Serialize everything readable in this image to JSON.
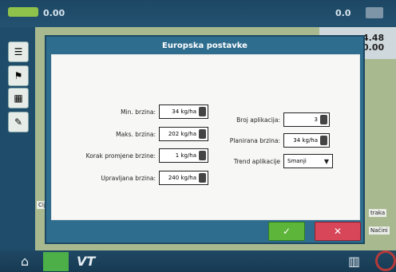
{
  "topbar": {
    "left_value": "0.00",
    "right_value": "0.0"
  },
  "right_panel": {
    "line1": "4.48",
    "line2": "0.00"
  },
  "background_labels": {
    "left": "Cij",
    "traka": "traka",
    "nacini": "Načini"
  },
  "dialog": {
    "title": "Europska postavke",
    "fields": {
      "min_brzina": {
        "label": "Min. brzina:",
        "value": "34 kg/ha"
      },
      "maks_brzina": {
        "label": "Maks. brzina:",
        "value": "202 kg/ha"
      },
      "korak_promjene": {
        "label": "Korak promjene brzine:",
        "value": "1 kg/ha"
      },
      "upravljana_brzina": {
        "label": "Upravljana brzina:",
        "value": "240 kg/ha"
      },
      "broj_aplikacija": {
        "label": "Broj aplikacija:",
        "value": "3"
      },
      "planirana_brzina": {
        "label": "Planirana brzina:",
        "value": "34 kg/ha"
      },
      "trend_aplikacije": {
        "label": "Trend aplikacije",
        "value": "Smanji"
      }
    },
    "buttons": {
      "ok": "✓",
      "cancel": "✕"
    }
  },
  "bottom": {
    "home_icon": "⌂",
    "vt": "VT"
  },
  "colors": {
    "ok": "#5db53a",
    "cancel": "#d8465a",
    "dialog_border": "#2f6d8f"
  }
}
